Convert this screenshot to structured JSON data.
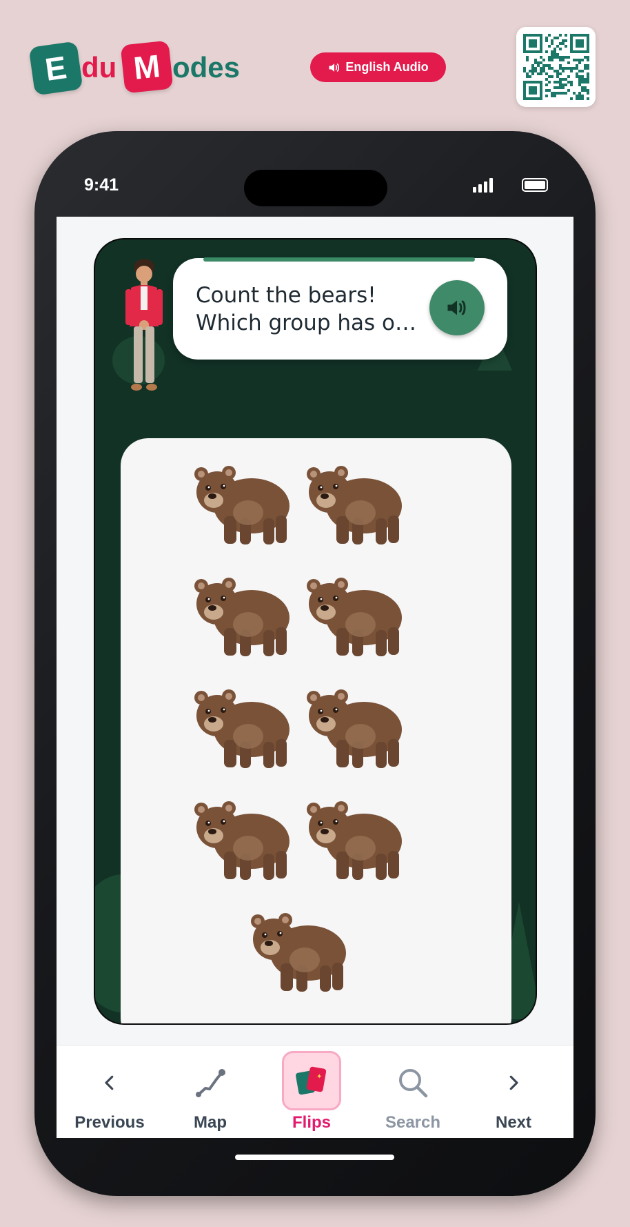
{
  "brand": {
    "tile1": "E",
    "text1": "du",
    "tile2": "M",
    "text2": "odes"
  },
  "audio_button": {
    "label": "English Audio"
  },
  "status_bar": {
    "time": "9:41"
  },
  "prompt": {
    "text": "Count the bears!\nWhich group has o…"
  },
  "bears": {
    "count": 9
  },
  "nav": {
    "items": [
      {
        "label": "Previous",
        "icon": "chevron-left-icon",
        "color": "#3b4654"
      },
      {
        "label": "Map",
        "icon": "route-icon",
        "color": "#3b4654"
      },
      {
        "label": "Flips",
        "icon": "flip-cards-icon",
        "color": "#e31b6e"
      },
      {
        "label": "Search",
        "icon": "search-icon",
        "color": "#8c96a3"
      },
      {
        "label": "Next",
        "icon": "chevron-right-icon",
        "color": "#3b4654"
      }
    ]
  },
  "colors": {
    "brand_teal": "#1b7868",
    "brand_red": "#e31b4d",
    "card_bg": "#123226",
    "speaker_green": "#3f8a68",
    "active_pink": "#e31b6e"
  }
}
